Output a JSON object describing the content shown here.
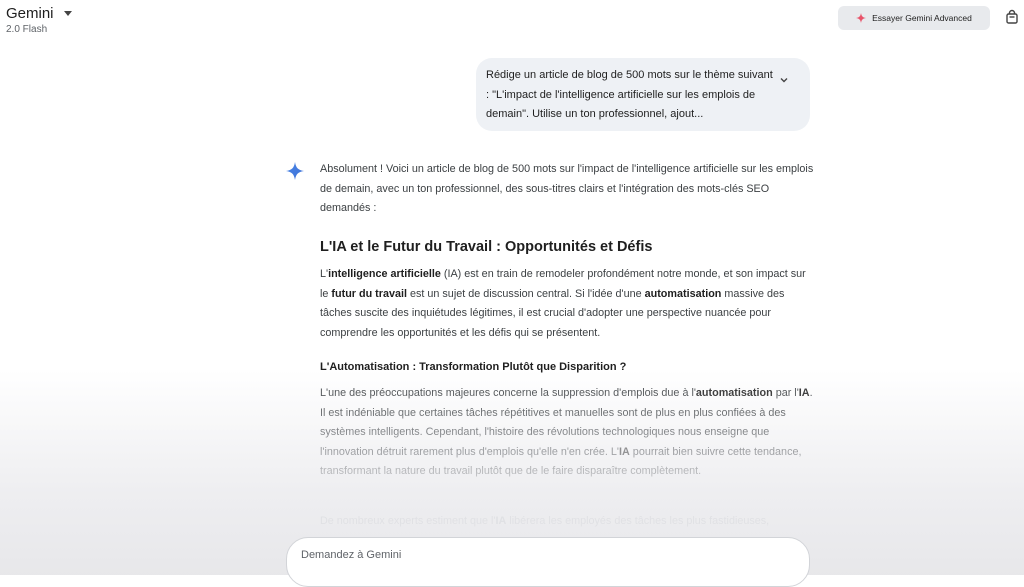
{
  "header": {
    "app_name": "Gemini",
    "model": "2.0 Flash",
    "advanced_button": "Essayer Gemini Advanced"
  },
  "user_prompt": {
    "text": "Rédige un article de blog de 500 mots sur le thème suivant : \"L'impact de l'intelligence artificielle sur les emplois de demain\". Utilise un ton professionnel, ajout..."
  },
  "response": {
    "intro": "Absolument ! Voici un article de blog de 500 mots sur l'impact de l'intelligence artificielle sur les emplois de demain, avec un ton professionnel, des sous-titres clairs et l'intégration des mots-clés SEO demandés :",
    "heading1": "L'IA et le Futur du Travail : Opportunités et Défis",
    "p1": {
      "a": "L'",
      "b": "intelligence artificielle",
      "c": " (IA) est en train de remodeler profondément notre monde, et son impact sur le ",
      "d": "futur du travail",
      "e": " est un sujet de discussion central. Si l'idée d'une ",
      "f": "automatisation",
      "g": " massive des tâches suscite des inquiétudes légitimes, il est crucial d'adopter une perspective nuancée pour comprendre les opportunités et les défis qui se présentent."
    },
    "heading2": "L'Automatisation : Transformation Plutôt que Disparition ?",
    "p2": {
      "a": "L'une des préoccupations majeures concerne la suppression d'emplois due à l'",
      "b": "automatisation",
      "c": " par l'",
      "d": "IA",
      "e": ". Il est indéniable que certaines tâches répétitives et manuelles sont de plus en plus confiées à des systèmes intelligents. Cependant, l'histoire des révolutions technologiques nous enseigne que l'innovation détruit rarement plus d'emplois qu'elle n'en crée. L'",
      "f": "IA",
      "g": " pourrait bien suivre cette tendance, transformant la nature du travail plutôt que de le faire disparaître complètement."
    },
    "p3": {
      "a": "De nombreux experts estiment que l'",
      "b": "IA",
      "c": " libérera les employés des tâches les plus fastidieuses,"
    }
  },
  "input": {
    "placeholder": "Demandez à Gemini"
  },
  "colors": {
    "accent_blue": "#4a86e8",
    "bubble_bg": "#eef1f5",
    "button_bg": "#e8eaed",
    "spark_pink": "#e8536a"
  }
}
